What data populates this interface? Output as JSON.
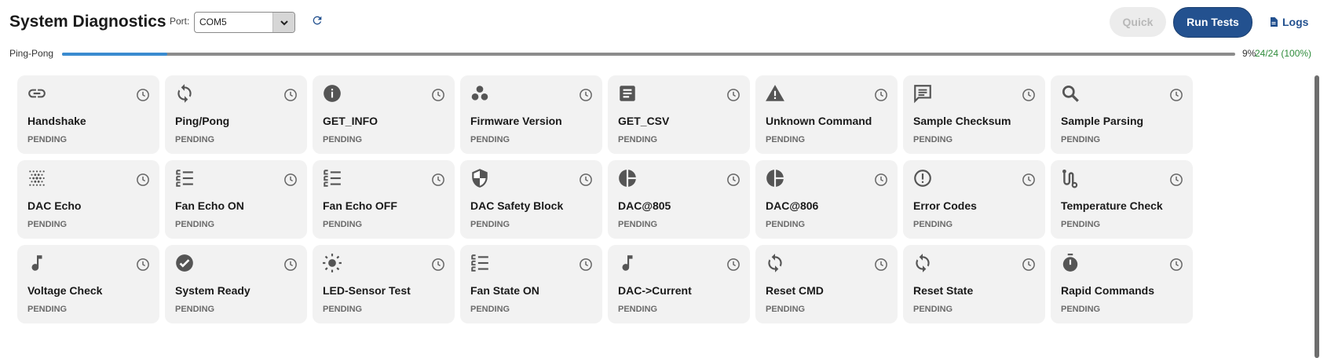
{
  "header": {
    "title": "System Diagnostics",
    "port_label": "Port:",
    "port_value": "COM5",
    "quick_label": "Quick",
    "run_label": "Run Tests",
    "logs_label": "Logs"
  },
  "progress": {
    "label": "Ping-Pong",
    "percent_text": "9%",
    "count_text": "24/24 (100%)",
    "fill_fraction": 0.09
  },
  "colors": {
    "accent": "#23518f",
    "progress_fill": "#3a8bd0",
    "success_text": "#2e8b3a"
  },
  "tests": [
    {
      "name": "Handshake",
      "status": "PENDING",
      "icon": "link-icon"
    },
    {
      "name": "Ping/Pong",
      "status": "PENDING",
      "icon": "sync-icon"
    },
    {
      "name": "GET_INFO",
      "status": "PENDING",
      "icon": "info-icon"
    },
    {
      "name": "Firmware Version",
      "status": "PENDING",
      "icon": "bubbles-icon"
    },
    {
      "name": "GET_CSV",
      "status": "PENDING",
      "icon": "document-icon"
    },
    {
      "name": "Unknown Command",
      "status": "PENDING",
      "icon": "warning-icon"
    },
    {
      "name": "Sample Checksum",
      "status": "PENDING",
      "icon": "message-icon"
    },
    {
      "name": "Sample Parsing",
      "status": "PENDING",
      "icon": "search-icon"
    },
    {
      "name": "DAC Echo",
      "status": "PENDING",
      "icon": "grain-icon"
    },
    {
      "name": "Fan Echo ON",
      "status": "PENDING",
      "icon": "checklist-icon"
    },
    {
      "name": "Fan Echo OFF",
      "status": "PENDING",
      "icon": "checklist-icon"
    },
    {
      "name": "DAC Safety Block",
      "status": "PENDING",
      "icon": "shield-icon"
    },
    {
      "name": "DAC@805",
      "status": "PENDING",
      "icon": "pie-chart-icon"
    },
    {
      "name": "DAC@806",
      "status": "PENDING",
      "icon": "pie-chart-icon"
    },
    {
      "name": "Error Codes",
      "status": "PENDING",
      "icon": "error-icon"
    },
    {
      "name": "Temperature Check",
      "status": "PENDING",
      "icon": "route-icon"
    },
    {
      "name": "Voltage Check",
      "status": "PENDING",
      "icon": "music-note-icon"
    },
    {
      "name": "System Ready",
      "status": "PENDING",
      "icon": "check-circle-icon"
    },
    {
      "name": "LED-Sensor Test",
      "status": "PENDING",
      "icon": "sun-icon"
    },
    {
      "name": "Fan State ON",
      "status": "PENDING",
      "icon": "checklist-icon"
    },
    {
      "name": "DAC->Current",
      "status": "PENDING",
      "icon": "music-note-icon"
    },
    {
      "name": "Reset CMD",
      "status": "PENDING",
      "icon": "sync-icon"
    },
    {
      "name": "Reset State",
      "status": "PENDING",
      "icon": "sync-icon"
    },
    {
      "name": "Rapid Commands",
      "status": "PENDING",
      "icon": "timer-icon"
    }
  ]
}
